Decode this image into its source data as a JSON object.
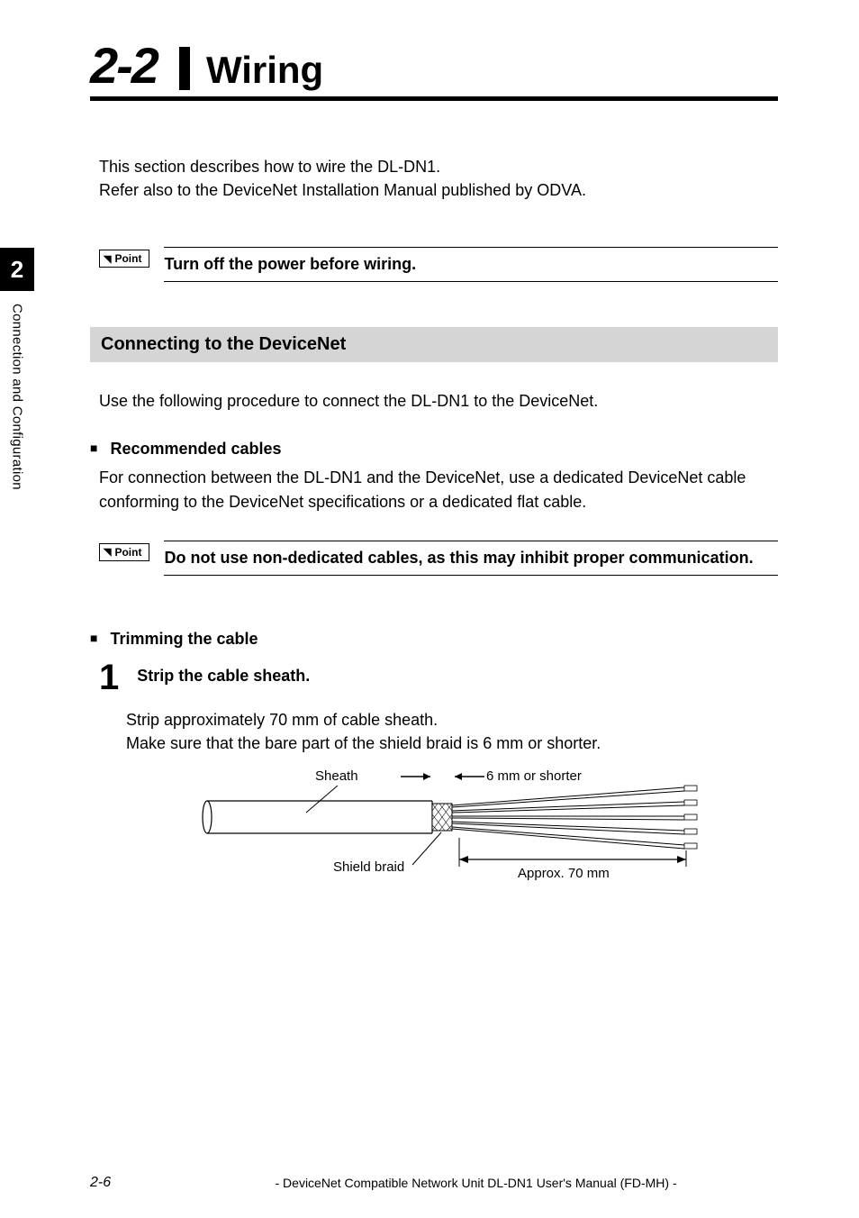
{
  "section": {
    "number": "2-2",
    "title": "Wiring"
  },
  "intro": {
    "line1": "This section describes how to wire the DL-DN1.",
    "line2": "Refer also to the DeviceNet Installation Manual published by ODVA."
  },
  "point1": {
    "badge": "Point",
    "text": "Turn off the power before wiring."
  },
  "subsection": {
    "title": "Connecting to the DeviceNet",
    "body": "Use the following procedure to connect the DL-DN1 to the DeviceNet."
  },
  "recommended": {
    "title": "Recommended cables",
    "body": "For connection between the DL-DN1 and the DeviceNet, use a dedicated DeviceNet cable conforming to the DeviceNet specifications or a dedicated flat cable."
  },
  "point2": {
    "badge": "Point",
    "text": "Do not use non-dedicated cables, as this may inhibit proper communication."
  },
  "trimming": {
    "title": "Trimming the cable",
    "step1": {
      "num": "1",
      "title": "Strip the cable sheath.",
      "body1": "Strip approximately 70 mm of cable sheath.",
      "body2": "Make sure that the bare part of the shield braid is 6 mm or shorter."
    }
  },
  "diagram": {
    "label_sheath": "Sheath",
    "label_short": "6 mm or shorter",
    "label_braid": "Shield braid",
    "label_approx": "Approx. 70 mm"
  },
  "sidebar": {
    "chapter": "2",
    "label": "Connection and Configuration"
  },
  "footer": {
    "page": "2-6",
    "title": "- DeviceNet Compatible Network Unit DL-DN1 User's Manual (FD-MH) -"
  }
}
